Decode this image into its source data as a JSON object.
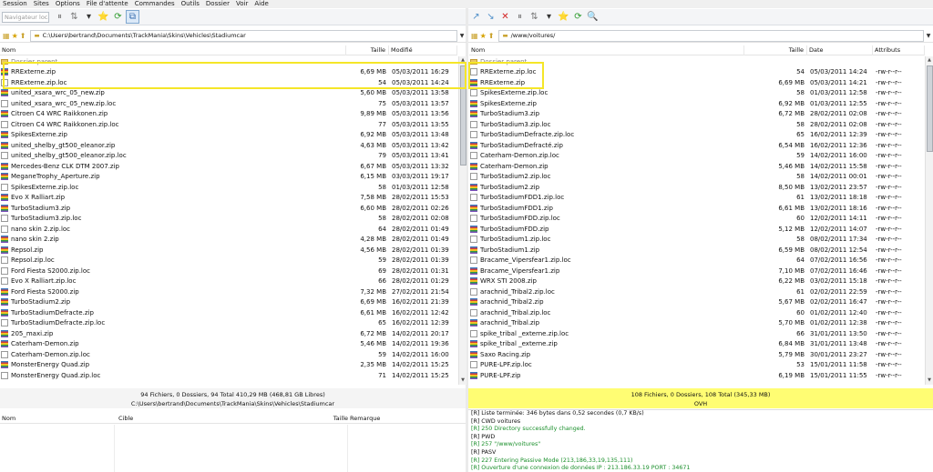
{
  "menu": [
    "Session",
    "Sites",
    "Options",
    "File d'attente",
    "Commandes",
    "Outils",
    "Dossier",
    "Voir",
    "Aide"
  ],
  "toolbar_left": {
    "site_label": "Navigateur local",
    "icons": [
      "pause-icon",
      "transfer-icon",
      "dropdown-icon",
      "bookmark-icon",
      "refresh-icon",
      "sync-browse-icon"
    ],
    "glyphs": [
      "⏸",
      "⇅",
      "▾",
      "⭐",
      "⟳",
      "⧉"
    ]
  },
  "toolbar_right": {
    "icons": [
      "connect-icon",
      "disconnect-icon",
      "abort-icon",
      "pause-icon",
      "transfer-icon",
      "dropdown-icon",
      "bookmark-icon",
      "refresh-icon",
      "find-icon"
    ],
    "glyphs": [
      "↗",
      "↘",
      "✕",
      "⏸",
      "⇅",
      "▾",
      "⭐",
      "⟳",
      "🔍"
    ]
  },
  "path_left": "C:\\Users\\bertrand\\Documents\\TrackMania\\Skins\\Vehicles\\Stadiumcar",
  "path_right": "/www/voitures/",
  "columns_left": {
    "name": "Nom",
    "size": "Taille",
    "date": "Modifié"
  },
  "columns_right": {
    "name": "Nom",
    "size": "Taille",
    "date": "Date",
    "attr": "Attributs"
  },
  "files_left": [
    {
      "name": "Dossier parent",
      "size": "",
      "date": "",
      "kind": "folder"
    },
    {
      "name": "RRExterne.zip",
      "size": "6,69 MB",
      "date": "05/03/2011 16:29",
      "kind": "zip"
    },
    {
      "name": "RRExterne.zip.loc",
      "size": "54",
      "date": "05/03/2011 14:24",
      "kind": "doc"
    },
    {
      "name": "united_xsara_wrc_05_new.zip",
      "size": "5,60 MB",
      "date": "05/03/2011 13:58",
      "kind": "zip"
    },
    {
      "name": "united_xsara_wrc_05_new.zip.loc",
      "size": "75",
      "date": "05/03/2011 13:57",
      "kind": "doc"
    },
    {
      "name": "Citroen C4 WRC Raikkonen.zip",
      "size": "9,89 MB",
      "date": "05/03/2011 13:56",
      "kind": "zip"
    },
    {
      "name": "Citroen C4 WRC Raikkonen.zip.loc",
      "size": "77",
      "date": "05/03/2011 13:55",
      "kind": "doc"
    },
    {
      "name": "SpikesExterne.zip",
      "size": "6,92 MB",
      "date": "05/03/2011 13:48",
      "kind": "zip"
    },
    {
      "name": "united_shelby_gt500_eleanor.zip",
      "size": "4,63 MB",
      "date": "05/03/2011 13:42",
      "kind": "zip"
    },
    {
      "name": "united_shelby_gt500_eleanor.zip.loc",
      "size": "79",
      "date": "05/03/2011 13:41",
      "kind": "doc"
    },
    {
      "name": "Mercedes-Benz CLK DTM 2007.zip",
      "size": "6,67 MB",
      "date": "05/03/2011 13:32",
      "kind": "zip"
    },
    {
      "name": "MeganeTrophy_Aperture.zip",
      "size": "6,15 MB",
      "date": "03/03/2011 19:17",
      "kind": "zip"
    },
    {
      "name": "SpikesExterne.zip.loc",
      "size": "58",
      "date": "01/03/2011 12:58",
      "kind": "doc"
    },
    {
      "name": "Evo X Ralliart.zip",
      "size": "7,58 MB",
      "date": "28/02/2011 15:53",
      "kind": "zip"
    },
    {
      "name": "TurboStadium3.zip",
      "size": "6,60 MB",
      "date": "28/02/2011 02:26",
      "kind": "zip"
    },
    {
      "name": "TurboStadium3.zip.loc",
      "size": "58",
      "date": "28/02/2011 02:08",
      "kind": "doc"
    },
    {
      "name": "nano skin 2.zip.loc",
      "size": "64",
      "date": "28/02/2011 01:49",
      "kind": "doc"
    },
    {
      "name": "nano skin 2.zip",
      "size": "4,28 MB",
      "date": "28/02/2011 01:49",
      "kind": "zip"
    },
    {
      "name": "Repsol.zip",
      "size": "4,56 MB",
      "date": "28/02/2011 01:39",
      "kind": "zip"
    },
    {
      "name": "Repsol.zip.loc",
      "size": "59",
      "date": "28/02/2011 01:39",
      "kind": "doc"
    },
    {
      "name": "Ford Fiesta S2000.zip.loc",
      "size": "69",
      "date": "28/02/2011 01:31",
      "kind": "doc"
    },
    {
      "name": "Evo X Ralliart.zip.loc",
      "size": "66",
      "date": "28/02/2011 01:29",
      "kind": "doc"
    },
    {
      "name": "Ford Fiesta S2000.zip",
      "size": "7,32 MB",
      "date": "27/02/2011 21:54",
      "kind": "zip"
    },
    {
      "name": "TurboStadium2.zip",
      "size": "6,69 MB",
      "date": "16/02/2011 21:39",
      "kind": "zip"
    },
    {
      "name": "TurboStadiumDefracte.zip",
      "size": "6,61 MB",
      "date": "16/02/2011 12:42",
      "kind": "zip"
    },
    {
      "name": "TurboStadiumDefracte.zip.loc",
      "size": "65",
      "date": "16/02/2011 12:39",
      "kind": "doc"
    },
    {
      "name": "205_maxi.zip",
      "size": "6,72 MB",
      "date": "14/02/2011 20:17",
      "kind": "zip"
    },
    {
      "name": "Caterham-Demon.zip",
      "size": "5,46 MB",
      "date": "14/02/2011 19:36",
      "kind": "zip"
    },
    {
      "name": "Caterham-Demon.zip.loc",
      "size": "59",
      "date": "14/02/2011 16:00",
      "kind": "doc"
    },
    {
      "name": "MonsterEnergy Quad.zip",
      "size": "2,35 MB",
      "date": "14/02/2011 15:25",
      "kind": "zip"
    },
    {
      "name": "MonsterEnergy Quad.zip.loc",
      "size": "71",
      "date": "14/02/2011 15:25",
      "kind": "doc"
    }
  ],
  "files_right": [
    {
      "name": "Dossier parent",
      "size": "",
      "date": "",
      "attr": "",
      "kind": "folder"
    },
    {
      "name": "RRExterne.zip.loc",
      "size": "54",
      "date": "05/03/2011 14:24",
      "attr": "-rw-r--r--",
      "kind": "doc"
    },
    {
      "name": "RRExterne.zip",
      "size": "6,69 MB",
      "date": "05/03/2011 14:21",
      "attr": "-rw-r--r--",
      "kind": "zip"
    },
    {
      "name": "SpikesExterne.zip.loc",
      "size": "58",
      "date": "01/03/2011 12:58",
      "attr": "-rw-r--r--",
      "kind": "doc"
    },
    {
      "name": "SpikesExterne.zip",
      "size": "6,92 MB",
      "date": "01/03/2011 12:55",
      "attr": "-rw-r--r--",
      "kind": "zip"
    },
    {
      "name": "TurboStadium3.zip",
      "size": "6,72 MB",
      "date": "28/02/2011 02:08",
      "attr": "-rw-r--r--",
      "kind": "zip"
    },
    {
      "name": "TurboStadium3.zip.loc",
      "size": "58",
      "date": "28/02/2011 02:08",
      "attr": "-rw-r--r--",
      "kind": "doc"
    },
    {
      "name": "TurboStadiumDefracte.zip.loc",
      "size": "65",
      "date": "16/02/2011 12:39",
      "attr": "-rw-r--r--",
      "kind": "doc"
    },
    {
      "name": "TurboStadiumDefracté.zip",
      "size": "6,54 MB",
      "date": "16/02/2011 12:36",
      "attr": "-rw-r--r--",
      "kind": "zip"
    },
    {
      "name": "Caterham-Demon.zip.loc",
      "size": "59",
      "date": "14/02/2011 16:00",
      "attr": "-rw-r--r--",
      "kind": "doc"
    },
    {
      "name": "Caterham-Demon.zip",
      "size": "5,46 MB",
      "date": "14/02/2011 15:58",
      "attr": "-rw-r--r--",
      "kind": "zip"
    },
    {
      "name": "TurboStadium2.zip.loc",
      "size": "58",
      "date": "14/02/2011 00:01",
      "attr": "-rw-r--r--",
      "kind": "doc"
    },
    {
      "name": "TurboStadium2.zip",
      "size": "8,50 MB",
      "date": "13/02/2011 23:57",
      "attr": "-rw-r--r--",
      "kind": "zip"
    },
    {
      "name": "TurboStadiumFDD1.zip.loc",
      "size": "61",
      "date": "13/02/2011 18:18",
      "attr": "-rw-r--r--",
      "kind": "doc"
    },
    {
      "name": "TurboStadiumFDD1.zip",
      "size": "6,61 MB",
      "date": "13/02/2011 18:16",
      "attr": "-rw-r--r--",
      "kind": "zip"
    },
    {
      "name": "TurboStadiumFDD.zip.loc",
      "size": "60",
      "date": "12/02/2011 14:11",
      "attr": "-rw-r--r--",
      "kind": "doc"
    },
    {
      "name": "TurboStadiumFDD.zip",
      "size": "5,12 MB",
      "date": "12/02/2011 14:07",
      "attr": "-rw-r--r--",
      "kind": "zip"
    },
    {
      "name": "TurboStadium1.zip.loc",
      "size": "58",
      "date": "08/02/2011 17:34",
      "attr": "-rw-r--r--",
      "kind": "doc"
    },
    {
      "name": "TurboStadium1.zip",
      "size": "6,59 MB",
      "date": "08/02/2011 12:54",
      "attr": "-rw-r--r--",
      "kind": "zip"
    },
    {
      "name": "Bracame_Vipersfear1.zip.loc",
      "size": "64",
      "date": "07/02/2011 16:56",
      "attr": "-rw-r--r--",
      "kind": "doc"
    },
    {
      "name": "Bracame_Vipersfear1.zip",
      "size": "7,10 MB",
      "date": "07/02/2011 16:46",
      "attr": "-rw-r--r--",
      "kind": "zip"
    },
    {
      "name": "WRX STI 2008.zip",
      "size": "6,22 MB",
      "date": "03/02/2011 15:18",
      "attr": "-rw-r--r--",
      "kind": "zip"
    },
    {
      "name": "arachnid_Tribal2.zip.loc",
      "size": "61",
      "date": "02/02/2011 22:59",
      "attr": "-rw-r--r--",
      "kind": "doc"
    },
    {
      "name": "arachnid_Tribal2.zip",
      "size": "5,67 MB",
      "date": "02/02/2011 16:47",
      "attr": "-rw-r--r--",
      "kind": "zip"
    },
    {
      "name": "arachnid_Tribal.zip.loc",
      "size": "60",
      "date": "01/02/2011 12:40",
      "attr": "-rw-r--r--",
      "kind": "doc"
    },
    {
      "name": "arachnid_Tribal.zip",
      "size": "5,70 MB",
      "date": "01/02/2011 12:38",
      "attr": "-rw-r--r--",
      "kind": "zip"
    },
    {
      "name": "spike_tribal _externe.zip.loc",
      "size": "66",
      "date": "31/01/2011 13:50",
      "attr": "-rw-r--r--",
      "kind": "doc"
    },
    {
      "name": "spike_tribal _externe.zip",
      "size": "6,84 MB",
      "date": "31/01/2011 13:48",
      "attr": "-rw-r--r--",
      "kind": "zip"
    },
    {
      "name": "Saxo Racing.zip",
      "size": "5,79 MB",
      "date": "30/01/2011 23:27",
      "attr": "-rw-r--r--",
      "kind": "zip"
    },
    {
      "name": "PURE-LPF.zip.loc",
      "size": "53",
      "date": "15/01/2011 11:58",
      "attr": "-rw-r--r--",
      "kind": "doc"
    },
    {
      "name": "PURE-LPF.zip",
      "size": "6,19 MB",
      "date": "15/01/2011 11:55",
      "attr": "-rw-r--r--",
      "kind": "zip"
    }
  ],
  "status_left": {
    "line1": "94 Fichiers, 0 Dossiers, 94 Total 410,29 MB (468,81 GB Libres)",
    "line2": "C:\\Users\\bertrand\\Documents\\TrackMania\\Skins\\Vehicles\\Stadiumcar"
  },
  "status_right": {
    "line1": "108 Fichiers, 0 Dossiers, 108 Total (345,33 MB)",
    "line2": "OVH"
  },
  "queue_columns": {
    "name": "Nom",
    "target": "Cible",
    "size": "Taille",
    "remark": "Remarque"
  },
  "log": [
    {
      "text": "[R] Liste terminée: 346 bytes dans 0,52 secondes (0,7 KB/s)",
      "green": false
    },
    {
      "text": "[R] CWD voitures",
      "green": false
    },
    {
      "text": "[R] 250 Directory successfully changed.",
      "green": true
    },
    {
      "text": "[R] PWD",
      "green": false
    },
    {
      "text": "[R] 257 \"/www/voitures\"",
      "green": true
    },
    {
      "text": "[R] PASV",
      "green": false
    },
    {
      "text": "[R] 227 Entering Passive Mode (213,186,33,19,135,111)",
      "green": true
    },
    {
      "text": "[R] Ouverture d'une connexion de données IP : 213.186.33.19 PORT : 34671",
      "green": true
    }
  ],
  "colors": {
    "highlight": "#f5e628",
    "status_right_bg": "#fffd73",
    "log_green": "#1a8f2b"
  }
}
